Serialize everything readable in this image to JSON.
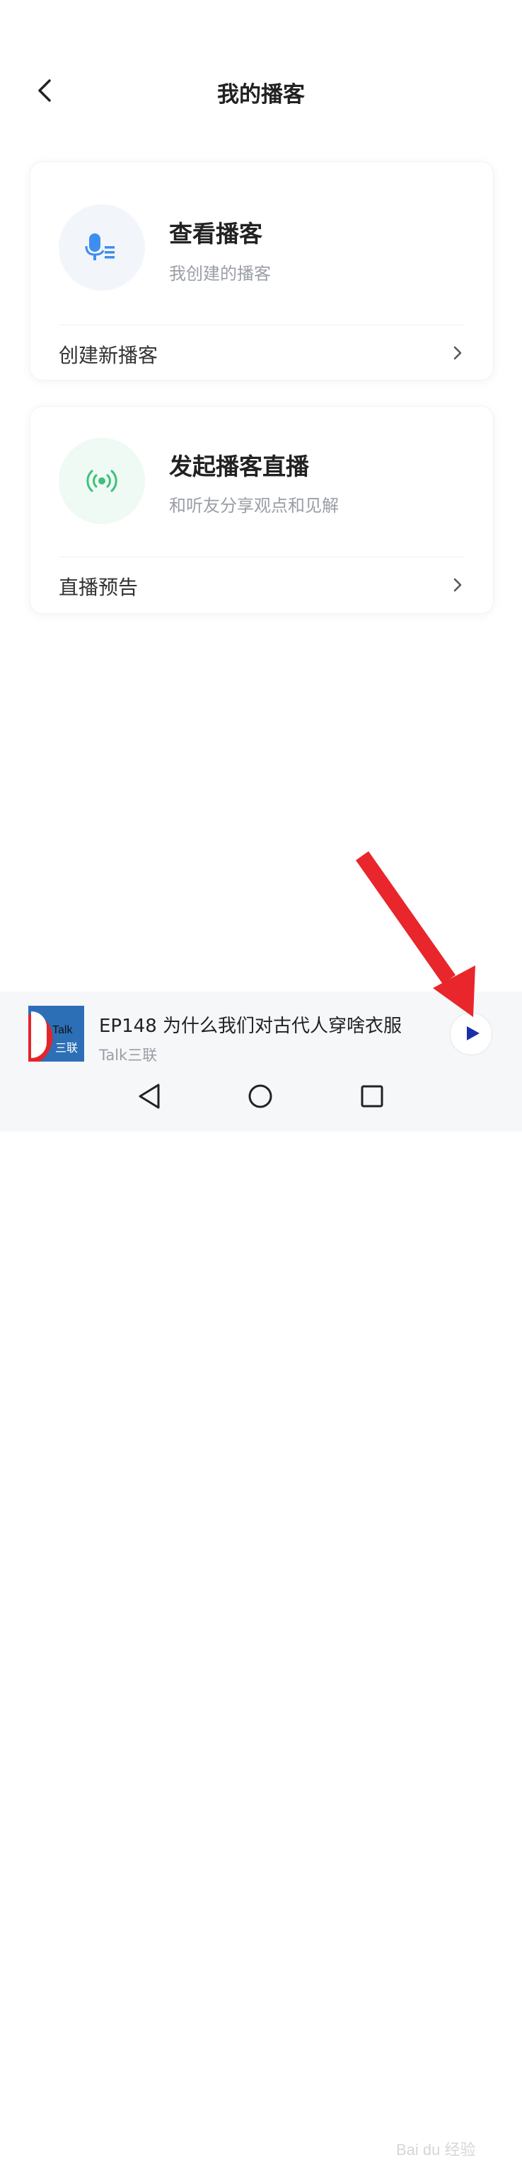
{
  "header": {
    "title": "我的播客",
    "back_icon": "chevron-left-icon"
  },
  "cards": [
    {
      "icon": "microphone-list-icon",
      "icon_color": "#3d8ef0",
      "title": "查看播客",
      "subtitle": "我创建的播客",
      "row_label": "创建新播客"
    },
    {
      "icon": "broadcast-icon",
      "icon_color": "#3fc07c",
      "title": "发起播客直播",
      "subtitle": "和听友分享观点和见解",
      "row_label": "直播预告"
    }
  ],
  "player": {
    "cover": {
      "text_top": "Talk",
      "text_bottom": "三联"
    },
    "track_title": "EP148 为什么我们对古代人穿啥衣服",
    "author": "Talk三联",
    "play_icon": "play-icon",
    "accent": "#1c2fa8"
  },
  "nav": {
    "icons": [
      "back-triangle-icon",
      "home-circle-icon",
      "recents-square-icon"
    ]
  },
  "overlay": {
    "arrow_color": "#e8262b",
    "watermark": "Bai du 经验"
  }
}
